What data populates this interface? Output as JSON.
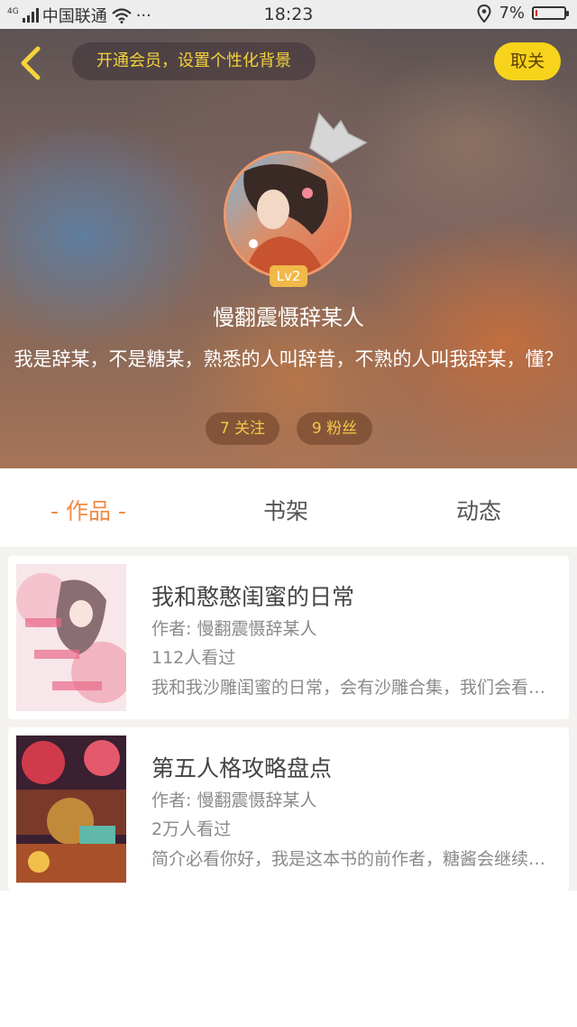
{
  "status_bar": {
    "network": "4G",
    "carrier": "中国联通",
    "more": "···",
    "time": "18:23",
    "battery": "7%",
    "battery_level": 0.07
  },
  "header": {
    "promo_text": "开通会员，设置个性化背景",
    "unfollow_label": "取关"
  },
  "profile": {
    "level": "Lv2",
    "username": "慢翻震慑辞某人",
    "bio": "我是辞某，不是糖某，熟悉的人叫辞昔，不熟的人叫我辞某，懂？",
    "following": "7 关注",
    "fans": "9 粉丝"
  },
  "tabs": [
    {
      "label": "- 作品 -",
      "active": true
    },
    {
      "label": "书架",
      "active": false
    },
    {
      "label": "动态",
      "active": false
    }
  ],
  "books": [
    {
      "title": "我和憨憨闺蜜的日常",
      "author": "作者: 慢翻震慑辞某人",
      "views": "112人看过",
      "description": "我和我沙雕闺蜜的日常，会有沙雕合集，我们会看到更多精彩的故事"
    },
    {
      "title": "第五人格攻略盘点",
      "author": "作者: 慢翻震慑辞某人",
      "views": "2万人看过",
      "description": "简介必看你好，我是这本书的前作者，糖酱会继续更新下去的"
    }
  ],
  "colors": {
    "accent": "#f08a45",
    "promo_text": "#f5d33b",
    "unfollow_bg": "#f7d31c",
    "level_badge": "#f1b84a"
  }
}
